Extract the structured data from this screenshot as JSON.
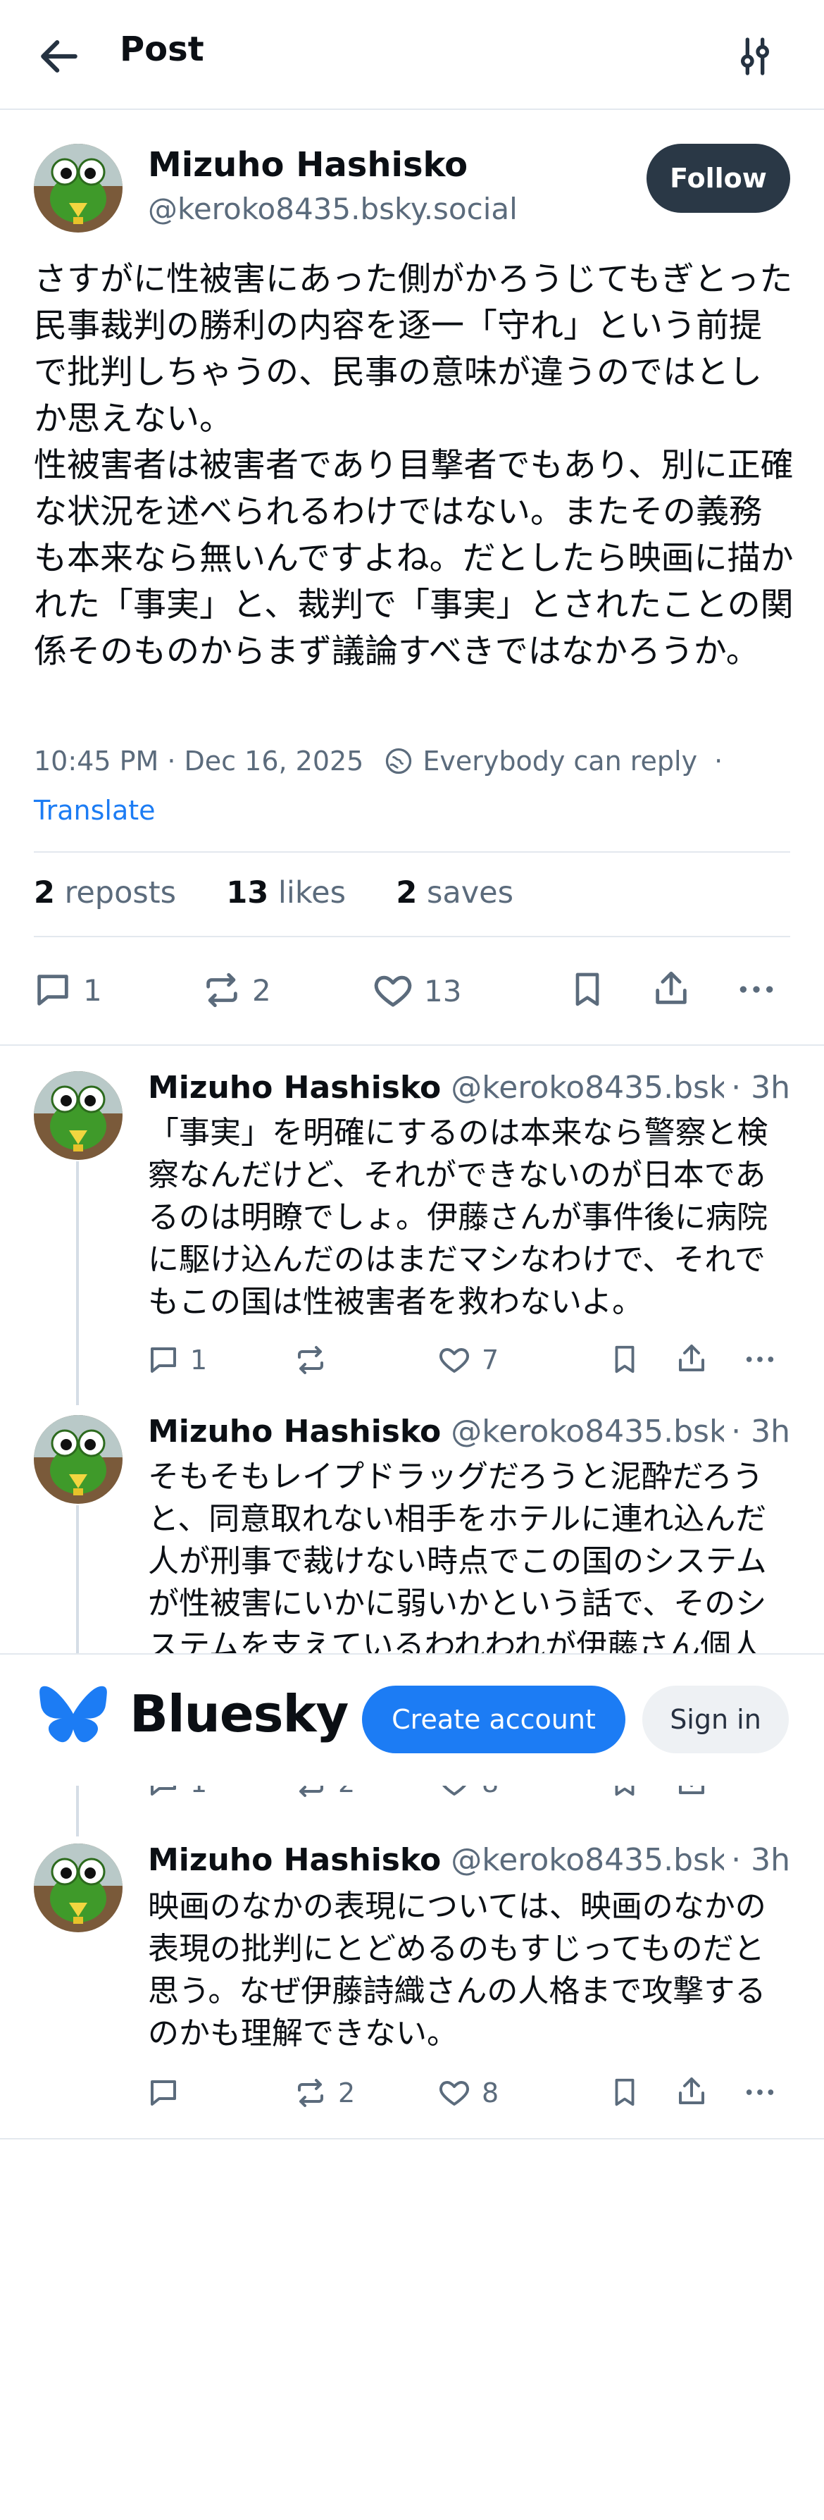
{
  "header": {
    "title": "Post"
  },
  "main_post": {
    "author_name": "Mizuho Hashisko",
    "author_handle": "@keroko8435.bsky.social",
    "follow_label": "Follow",
    "text": "さすがに性被害にあった側がかろうじてもぎとった民事裁判の勝利の内容を逐一「守れ」という前提で批判しちゃうの、民事の意味が違うのではとしか思えない。\n性被害者は被害者であり目撃者でもあり、別に正確な状況を述べられるわけではない。またその義務も本来なら無いんですよね。だとしたら映画に描かれた「事実」と、裁判で「事実」とされたことの関係そのものからまず議論すべきではなかろうか。",
    "timestamp": "10:45 PM · Dec 16, 2025",
    "reply_setting": "Everybody can reply",
    "separator": "·",
    "translate_label": "Translate",
    "stats": {
      "reposts_count": "2",
      "reposts_label": "reposts",
      "likes_count": "13",
      "likes_label": "likes",
      "saves_count": "2",
      "saves_label": "saves"
    },
    "actions": {
      "replies": "1",
      "reposts": "2",
      "likes": "13"
    }
  },
  "replies": [
    {
      "author_name": "Mizuho Hashisko",
      "author_handle": "@keroko8435.bsk...",
      "time": "· 3h",
      "text": "「事実」を明確にするのは本来なら警察と検察なんだけど、それができないのが日本であるのは明瞭でしょ。伊藤さんが事件後に病院に駆け込んだのはまだマシなわけで、それでもこの国は性被害者を救わないよ。",
      "replies": "1",
      "reposts": "",
      "likes": "7"
    },
    {
      "author_name": "Mizuho Hashisko",
      "author_handle": "@keroko8435.bsk...",
      "time": "· 3h",
      "text": "そもそもレイプドラッグだろうと泥酔だろうと、同意取れない相手をホテルに連れ込んだ人が刑事で裁けない時点でこの国のシステムが性被害にいかに弱いかという話で、そのシステムを支えているわれわれが伊藤さん個人",
      "replies": "1",
      "reposts": "2",
      "likes": "8"
    },
    {
      "author_name": "Mizuho Hashisko",
      "author_handle": "@keroko8435.bsk...",
      "time": "· 3h",
      "text": "映画のなかの表現については、映画のなかの表現の批判にとどめるのもすじってものだと思う。なぜ伊藤詩織さんの人格まで攻撃するのかも理解できない。",
      "replies": "",
      "reposts": "2",
      "likes": "8"
    }
  ],
  "banner": {
    "brand": "Bluesky",
    "create_account_label": "Create account",
    "sign_in_label": "Sign in"
  },
  "colors": {
    "accent": "#1c7cf4",
    "follow_bg": "#2a3846",
    "muted": "#5b6b7c"
  },
  "icons": [
    "back-arrow-icon",
    "filter-sliders-icon",
    "globe-reply-icon",
    "reply-icon",
    "repost-icon",
    "like-heart-icon",
    "bookmark-icon",
    "share-icon",
    "more-icon",
    "butterfly-logo-icon"
  ]
}
